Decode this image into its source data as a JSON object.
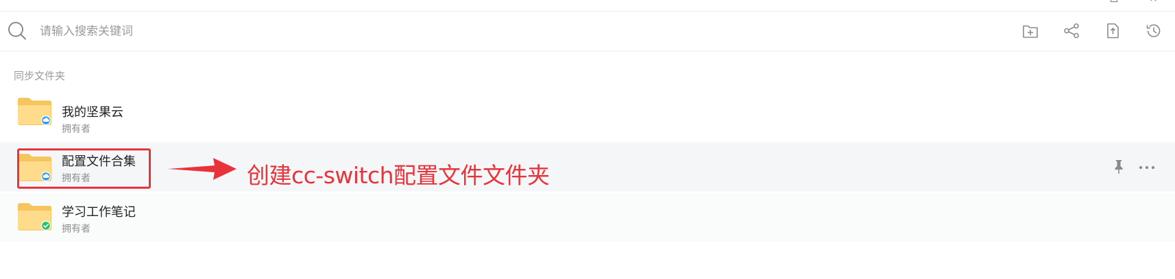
{
  "search": {
    "placeholder": "请输入搜索关键词"
  },
  "toolbar": {
    "icons": [
      "new-folder-icon",
      "share-icon",
      "upload-file-icon",
      "history-icon"
    ]
  },
  "section": {
    "title": "同步文件夹"
  },
  "folders": [
    {
      "name": "我的坚果云",
      "subtitle": "拥有者",
      "badge": "cloud-sync-icon",
      "badge_color": "#2f9bf0"
    },
    {
      "name": "配置文件合集",
      "subtitle": "拥有者",
      "badge": "cloud-sync-icon",
      "badge_color": "#2f9bf0"
    },
    {
      "name": "学习工作笔记",
      "subtitle": "拥有者",
      "badge": "check-icon",
      "badge_color": "#27c06b"
    }
  ],
  "annotation": {
    "text": "创建cc-switch配置文件文件夹",
    "color": "#e8333a"
  },
  "colors": {
    "folder": "#fbd37a",
    "folder_front": "#ffdf8e",
    "selected_row": "#f5f6f8"
  }
}
